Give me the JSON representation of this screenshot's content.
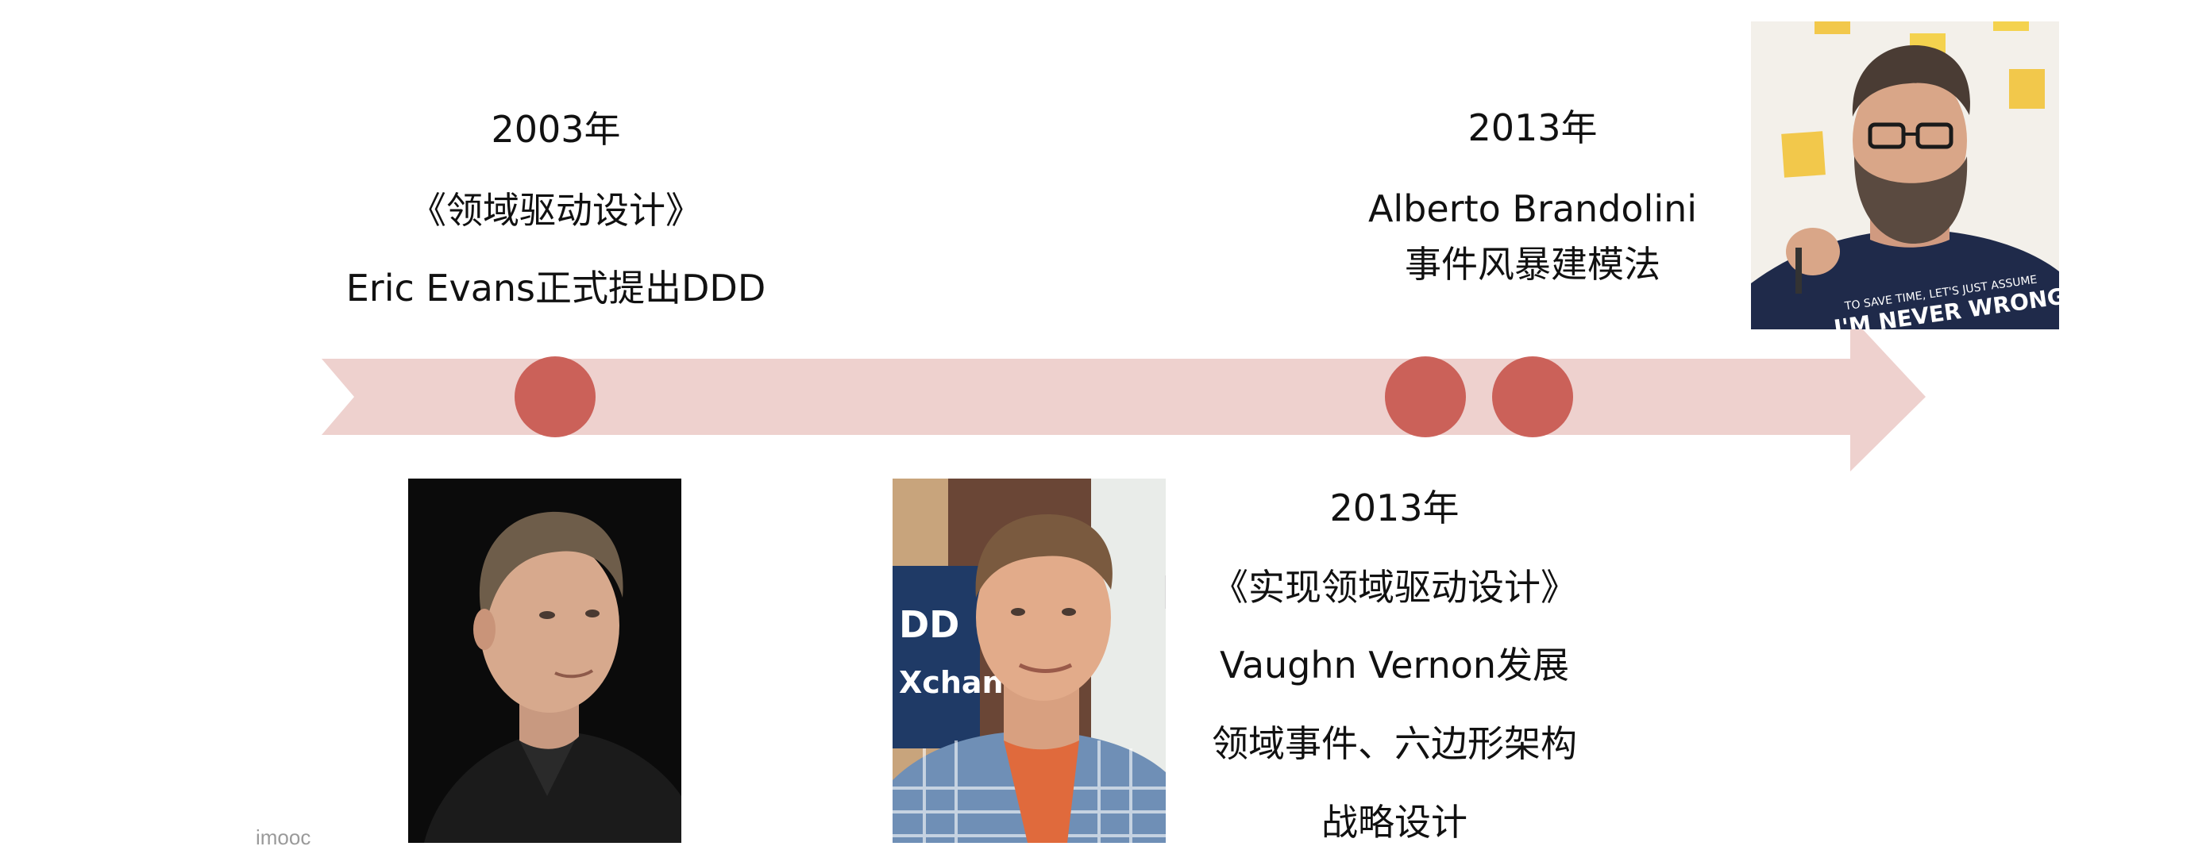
{
  "timeline": {
    "arrow_color": "#ebc9c6",
    "dot_color": "#c8574f",
    "events": [
      {
        "id": "evans",
        "year": "2003年",
        "title": "《领域驱动设计》",
        "desc": "Eric Evans正式提出DDD",
        "photo_icon": "person-photo-eric-evans"
      },
      {
        "id": "vernon",
        "year": "2013年",
        "title": "《实现领域驱动设计》",
        "desc": "Vaughn Vernon发展",
        "extra1": "领域事件、六边形架构",
        "extra2": "战略设计",
        "photo_icon": "person-photo-vaughn-vernon"
      },
      {
        "id": "brandolini",
        "year": "2013年",
        "name": "Alberto Brandolini",
        "desc": "事件风暴建模法",
        "photo_icon": "person-photo-alberto-brandolini",
        "shirt_text_1": "TO SAVE TIME, LET'S JUST ASSUME",
        "shirt_text_2": "I'M NEVER WRONG"
      }
    ]
  },
  "watermark": "imooc"
}
